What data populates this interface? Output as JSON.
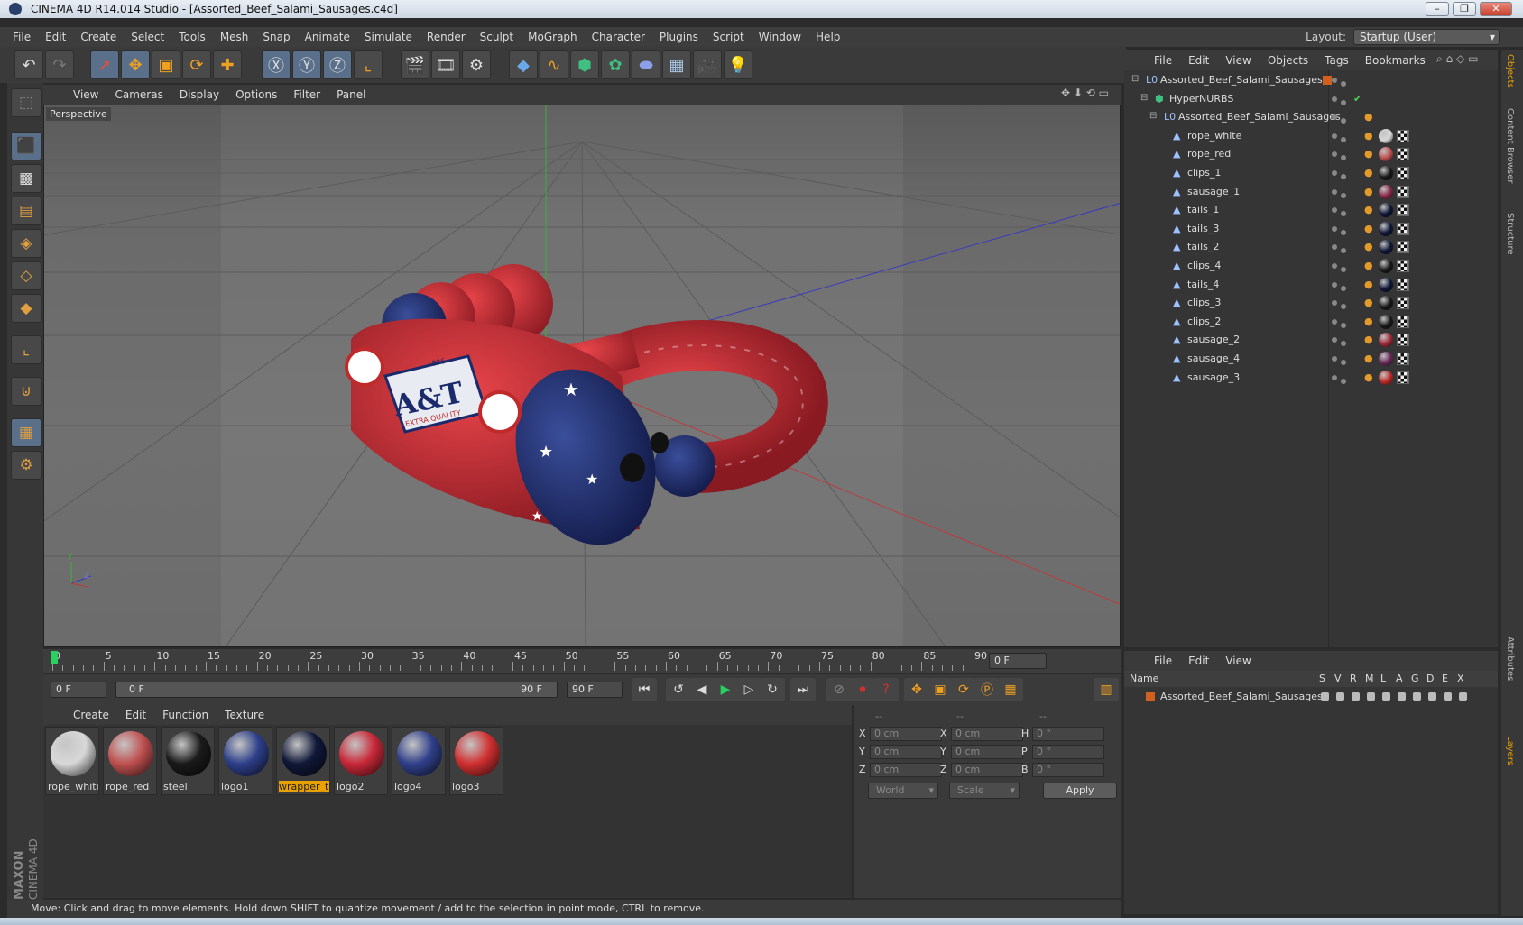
{
  "window": {
    "title": "CINEMA 4D R14.014 Studio - [Assorted_Beef_Salami_Sausages.c4d]"
  },
  "menubar": {
    "items": [
      "File",
      "Edit",
      "Create",
      "Select",
      "Tools",
      "Mesh",
      "Snap",
      "Animate",
      "Simulate",
      "Render",
      "Sculpt",
      "MoGraph",
      "Character",
      "Plugins",
      "Script",
      "Window",
      "Help"
    ],
    "layout_label": "Layout:",
    "layout_value": "Startup (User)"
  },
  "viewport": {
    "menu": [
      "View",
      "Cameras",
      "Display",
      "Options",
      "Filter",
      "Panel"
    ],
    "label": "Perspective",
    "axis_y": "Y",
    "axis_z": "Z",
    "product_text": "A&T",
    "product_subtext": "EXTRA QUALITY",
    "product_year": "1896"
  },
  "timeline": {
    "ticks": [
      "0",
      "5",
      "10",
      "15",
      "20",
      "25",
      "30",
      "35",
      "40",
      "45",
      "50",
      "55",
      "60",
      "65",
      "70",
      "75",
      "80",
      "85",
      "90"
    ],
    "current_frame": "0 F",
    "start_field": "0 F",
    "slider_start": "0 F",
    "slider_end": "90 F",
    "end_field": "90 F"
  },
  "material_manager": {
    "menu": [
      "Create",
      "Edit",
      "Function",
      "Texture"
    ],
    "materials": [
      {
        "name": "rope_white",
        "color": "#d8d8d8",
        "selected": false
      },
      {
        "name": "rope_red",
        "color": "#c05050",
        "selected": false
      },
      {
        "name": "steel",
        "color": "#1a1a1a",
        "selected": false
      },
      {
        "name": "logo1",
        "color": "#2d3f8a",
        "selected": false
      },
      {
        "name": "wrapper_ta",
        "color": "#101838",
        "selected": true
      },
      {
        "name": "logo2",
        "color": "#c82838",
        "selected": false
      },
      {
        "name": "logo4",
        "color": "#30408a",
        "selected": false
      },
      {
        "name": "logo3",
        "color": "#d03030",
        "selected": false
      }
    ]
  },
  "coordinates": {
    "headers": [
      "--",
      "--",
      "--"
    ],
    "rows": [
      {
        "l1": "X",
        "v1": "0 cm",
        "l2": "X",
        "v2": "0 cm",
        "l3": "H",
        "v3": "0 °"
      },
      {
        "l1": "Y",
        "v1": "0 cm",
        "l2": "Y",
        "v2": "0 cm",
        "l3": "P",
        "v3": "0 °"
      },
      {
        "l1": "Z",
        "v1": "0 cm",
        "l2": "Z",
        "v2": "0 cm",
        "l3": "B",
        "v3": "0 °"
      }
    ],
    "mode1": "World",
    "mode2": "Scale",
    "apply_label": "Apply"
  },
  "status": "Move: Click and drag to move elements. Hold down SHIFT to quantize movement / add to the selection in point mode, CTRL to remove.",
  "object_manager": {
    "menu": [
      "File",
      "Edit",
      "View",
      "Objects",
      "Tags",
      "Bookmarks"
    ],
    "objects": [
      {
        "name": "Assorted_Beef_Salami_Sausages",
        "indent": 0,
        "icon": "null",
        "tag": null
      },
      {
        "name": "HyperNURBS",
        "indent": 1,
        "icon": "nurbs",
        "tag": null
      },
      {
        "name": "Assorted_Beef_Salami_Sausages",
        "indent": 2,
        "icon": "null",
        "tag": null
      },
      {
        "name": "rope_white",
        "indent": 3,
        "icon": "poly",
        "tag": "#d8d8d8"
      },
      {
        "name": "rope_red",
        "indent": 3,
        "icon": "poly",
        "tag": "#c05050"
      },
      {
        "name": "clips_1",
        "indent": 3,
        "icon": "poly",
        "tag": "#1a1a1a"
      },
      {
        "name": "sausage_1",
        "indent": 3,
        "icon": "poly",
        "tag": "#8a2a4a"
      },
      {
        "name": "tails_1",
        "indent": 3,
        "icon": "poly",
        "tag": "#101838"
      },
      {
        "name": "tails_3",
        "indent": 3,
        "icon": "poly",
        "tag": "#101838"
      },
      {
        "name": "tails_2",
        "indent": 3,
        "icon": "poly",
        "tag": "#101838"
      },
      {
        "name": "clips_4",
        "indent": 3,
        "icon": "poly",
        "tag": "#1a1a1a"
      },
      {
        "name": "tails_4",
        "indent": 3,
        "icon": "poly",
        "tag": "#101838"
      },
      {
        "name": "clips_3",
        "indent": 3,
        "icon": "poly",
        "tag": "#1a1a1a"
      },
      {
        "name": "clips_2",
        "indent": 3,
        "icon": "poly",
        "tag": "#1a1a1a"
      },
      {
        "name": "sausage_2",
        "indent": 3,
        "icon": "poly",
        "tag": "#a02a3a"
      },
      {
        "name": "sausage_4",
        "indent": 3,
        "icon": "poly",
        "tag": "#6a2a5a"
      },
      {
        "name": "sausage_3",
        "indent": 3,
        "icon": "poly",
        "tag": "#c02a2a"
      }
    ]
  },
  "layer_manager": {
    "menu": [
      "File",
      "Edit",
      "View"
    ],
    "columns": [
      "Name",
      "S",
      "V",
      "R",
      "M",
      "L",
      "A",
      "G",
      "D",
      "E",
      "X"
    ],
    "layers": [
      {
        "name": "Assorted_Beef_Salami_Sausages",
        "color": "#d06020"
      }
    ]
  },
  "side_tabs": [
    "Objects",
    "Content Browser",
    "Structure",
    "Attributes",
    "Layers"
  ],
  "branding": {
    "vendor": "MAXON",
    "product": "CINEMA 4D"
  }
}
